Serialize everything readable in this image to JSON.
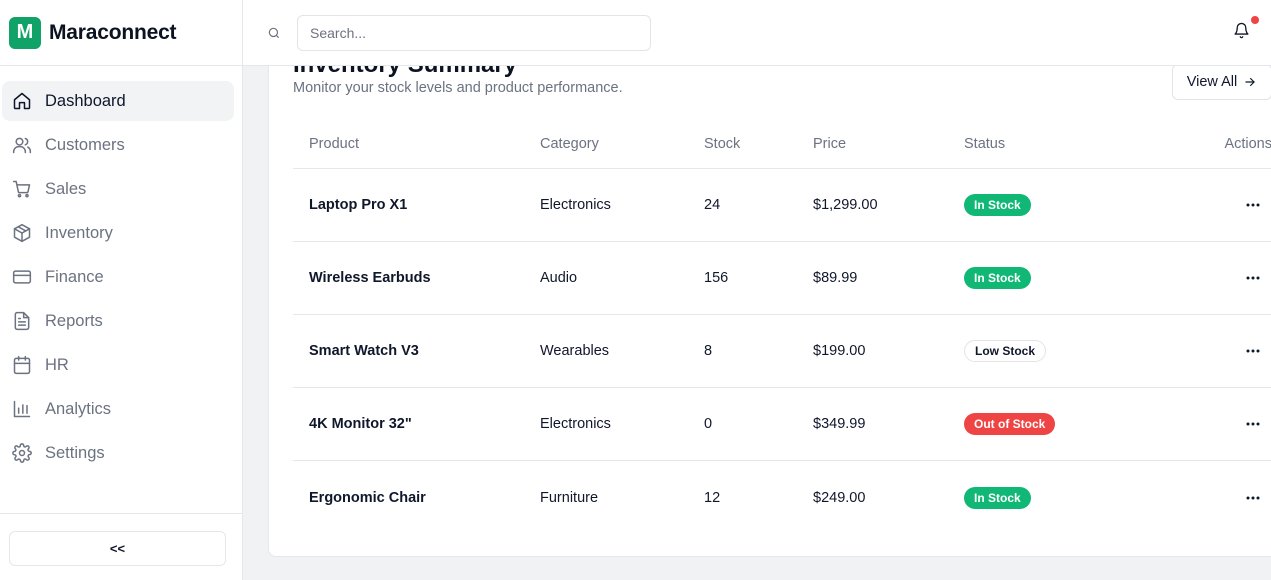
{
  "brand": {
    "logo_letter": "M",
    "name": "Maraconnect",
    "accent": "#10a266"
  },
  "sidebar": {
    "items": [
      {
        "label": "Dashboard",
        "icon": "home-icon",
        "active": true
      },
      {
        "label": "Customers",
        "icon": "users-icon"
      },
      {
        "label": "Sales",
        "icon": "cart-icon"
      },
      {
        "label": "Inventory",
        "icon": "package-icon"
      },
      {
        "label": "Finance",
        "icon": "credit-card-icon"
      },
      {
        "label": "Reports",
        "icon": "file-text-icon"
      },
      {
        "label": "HR",
        "icon": "calendar-icon"
      },
      {
        "label": "Analytics",
        "icon": "bar-chart-icon"
      },
      {
        "label": "Settings",
        "icon": "gear-icon"
      }
    ],
    "collapse_label": "<<"
  },
  "topbar": {
    "search_placeholder": "Search...",
    "search_value": "",
    "notification_dot_color": "#ef4444"
  },
  "inventory": {
    "title": "Inventory Summary",
    "subtitle": "Monitor your stock levels and product performance.",
    "view_all_label": "View All",
    "columns": [
      "Product",
      "Category",
      "Stock",
      "Price",
      "Status",
      "Actions"
    ],
    "rows": [
      {
        "product": "Laptop Pro X1",
        "category": "Electronics",
        "stock": "24",
        "price": "$1,299.00",
        "status": "In Stock",
        "status_kind": "in"
      },
      {
        "product": "Wireless Earbuds",
        "category": "Audio",
        "stock": "156",
        "price": "$89.99",
        "status": "In Stock",
        "status_kind": "in"
      },
      {
        "product": "Smart Watch V3",
        "category": "Wearables",
        "stock": "8",
        "price": "$199.00",
        "status": "Low Stock",
        "status_kind": "low"
      },
      {
        "product": "4K Monitor 32\"",
        "category": "Electronics",
        "stock": "0",
        "price": "$349.99",
        "status": "Out of Stock",
        "status_kind": "out"
      },
      {
        "product": "Ergonomic Chair",
        "category": "Furniture",
        "stock": "12",
        "price": "$249.00",
        "status": "In Stock",
        "status_kind": "in"
      }
    ],
    "status_colors": {
      "in": "#10b775",
      "low": "#ffffff",
      "out": "#ef4444"
    }
  }
}
